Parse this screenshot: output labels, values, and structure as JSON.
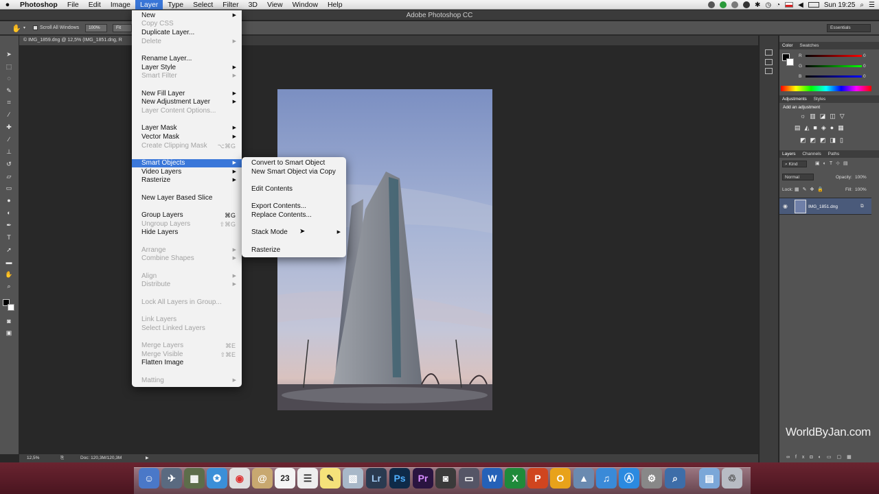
{
  "menubar": {
    "app_name": "Photoshop",
    "items": [
      "File",
      "Edit",
      "Image",
      "Layer",
      "Type",
      "Select",
      "Filter",
      "3D",
      "View",
      "Window",
      "Help"
    ],
    "clock": "Sun 19:25"
  },
  "window": {
    "title": "Adobe Photoshop CC"
  },
  "options": {
    "scroll_all": "Scroll All Windows",
    "zoom100": "100%",
    "fit_screen": "Fit Scre",
    "workspace": "Essentials"
  },
  "doc_tab": "© IMG_1859.dng @ 12,5% (IMG_1851.dng, R",
  "status": {
    "zoom": "12,5%",
    "doc": "Doc: 120,3M/120,3M"
  },
  "layer_menu": [
    {
      "label": "New",
      "arrow": true
    },
    {
      "label": "Copy CSS",
      "disabled": true
    },
    {
      "label": "Duplicate Layer..."
    },
    {
      "label": "Delete",
      "disabled": true,
      "arrow": true
    },
    {
      "label": "Rename Layer..."
    },
    {
      "label": "Layer Style",
      "arrow": true
    },
    {
      "label": "Smart Filter",
      "disabled": true,
      "arrow": true
    },
    {
      "label": "New Fill Layer",
      "arrow": true
    },
    {
      "label": "New Adjustment Layer",
      "arrow": true
    },
    {
      "label": "Layer Content Options...",
      "disabled": true
    },
    {
      "label": "Layer Mask",
      "arrow": true
    },
    {
      "label": "Vector Mask",
      "arrow": true
    },
    {
      "label": "Create Clipping Mask",
      "disabled": true,
      "shortcut": "⌥⌘G"
    },
    {
      "label": "Smart Objects",
      "arrow": true,
      "highlight": true
    },
    {
      "label": "Video Layers",
      "arrow": true
    },
    {
      "label": "Rasterize",
      "arrow": true
    },
    {
      "label": "New Layer Based Slice"
    },
    {
      "label": "Group Layers",
      "shortcut": "⌘G"
    },
    {
      "label": "Ungroup Layers",
      "disabled": true,
      "shortcut": "⇧⌘G"
    },
    {
      "label": "Hide Layers"
    },
    {
      "label": "Arrange",
      "disabled": true,
      "arrow": true
    },
    {
      "label": "Combine Shapes",
      "disabled": true,
      "arrow": true
    },
    {
      "label": "Align",
      "disabled": true,
      "arrow": true
    },
    {
      "label": "Distribute",
      "disabled": true,
      "arrow": true
    },
    {
      "label": "Lock All Layers in Group...",
      "disabled": true
    },
    {
      "label": "Link Layers",
      "disabled": true
    },
    {
      "label": "Select Linked Layers",
      "disabled": true
    },
    {
      "label": "Merge Layers",
      "disabled": true,
      "shortcut": "⌘E"
    },
    {
      "label": "Merge Visible",
      "disabled": true,
      "shortcut": "⇧⌘E"
    },
    {
      "label": "Flatten Image"
    },
    {
      "label": "Matting",
      "disabled": true,
      "arrow": true
    }
  ],
  "smart_objects_menu": [
    {
      "label": "Convert to Smart Object"
    },
    {
      "label": "New Smart Object via Copy"
    },
    {
      "label": "Edit Contents"
    },
    {
      "label": "Export Contents..."
    },
    {
      "label": "Replace Contents..."
    },
    {
      "label": "Stack Mode",
      "arrow": true
    },
    {
      "label": "Rasterize"
    }
  ],
  "panels": {
    "color_tabs": [
      "Color",
      "Swatches"
    ],
    "rgb": [
      {
        "ch": "R",
        "val": "0"
      },
      {
        "ch": "G",
        "val": "0"
      },
      {
        "ch": "B",
        "val": "0"
      }
    ],
    "adj_tabs": [
      "Adjustments",
      "Styles"
    ],
    "add_adjustment": "Add an adjustment",
    "layer_tabs": [
      "Layers",
      "Channels",
      "Paths"
    ],
    "kind": "Kind",
    "blend": "Normal",
    "opacity_label": "Opacity:",
    "opacity": "100%",
    "lock_label": "Lock:",
    "fill_label": "Fill:",
    "fill": "100%",
    "layer_name": "IMG_1851.dng"
  },
  "dock_letters": {
    "lr": "Lr",
    "ps": "Ps",
    "pr": "Pr",
    "w": "W",
    "x": "X",
    "p": "P",
    "o": "O",
    "cal": "23"
  },
  "watermark": "WorldByJan.com"
}
